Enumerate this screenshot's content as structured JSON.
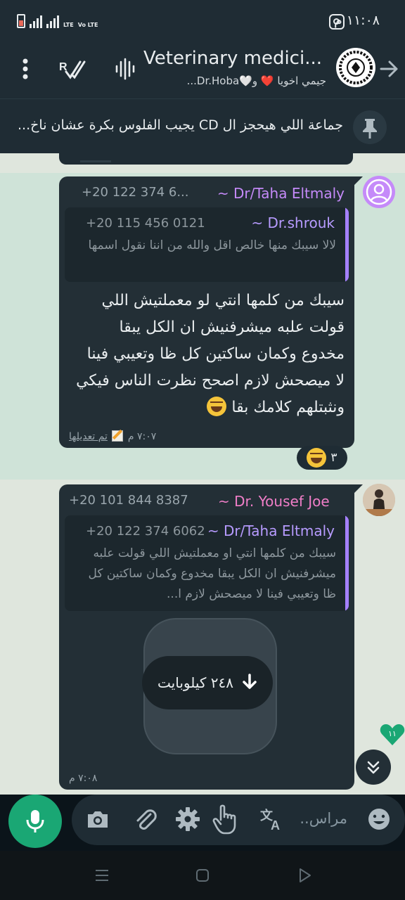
{
  "status_bar": {
    "time": "١١:٠٨ م",
    "network_labels": [
      "LTE",
      "Vo LTE"
    ]
  },
  "header": {
    "title": "Veterinary medici...",
    "subtitle": "جيمي اخويا ❤️ و🤍Dr.Hoba..."
  },
  "pinned": {
    "text": "جماعة اللي هيحجز ال CD يجيب الفلوس بكرة عشان ناخ..."
  },
  "messages": [
    {
      "sender": "~ Dr/Taha Eltmaly",
      "sender_color": "#c58af9",
      "phone": "+20 122 374 6...",
      "quote": {
        "sender": "~ Dr.shrouk",
        "phone": "+20 115 456 0121",
        "text": "لالا سيبك منها خالص اقل والله من اننا نقول اسمها"
      },
      "text": "سيبك من كلمها انتي لو معملتيش اللي قولت علبه ميشرفنيش ان الكل يبقا مخدوع وكمان ساكتين كل ظا وتعيبي فينا لا ميصحش لازم اصحح نظرت الناس فيكي ونثبتلهم كلامك بقا",
      "edited_label": "تم تعديلها",
      "time": "٧:٠٧ م",
      "reaction_count": "٣"
    },
    {
      "sender": "~ Dr. Yousef Joe",
      "sender_color": "#f07ec8",
      "phone": "+20 101 844 8387",
      "quote": {
        "sender": "~ Dr/Taha Eltmaly",
        "phone": "+20 122 374 6062",
        "text": "سيبك من كلمها انتي او معملتيش اللي قولت علبه ميشرفنيش ان الكل يبقا مخدوع وكمان ساكتين كل ظا وتعيبي فينا لا ميصحش لازم ا..."
      },
      "attachment_size": "٢٤٨ كيلوبايت",
      "time": "٧:٠٨ م"
    }
  ],
  "unread_count": "١١",
  "input": {
    "placeholder": "مراس.."
  },
  "colors": {
    "accent_green": "#1aa774",
    "quote_purple": "#a580ff",
    "bubble_dark": "#232f36"
  }
}
